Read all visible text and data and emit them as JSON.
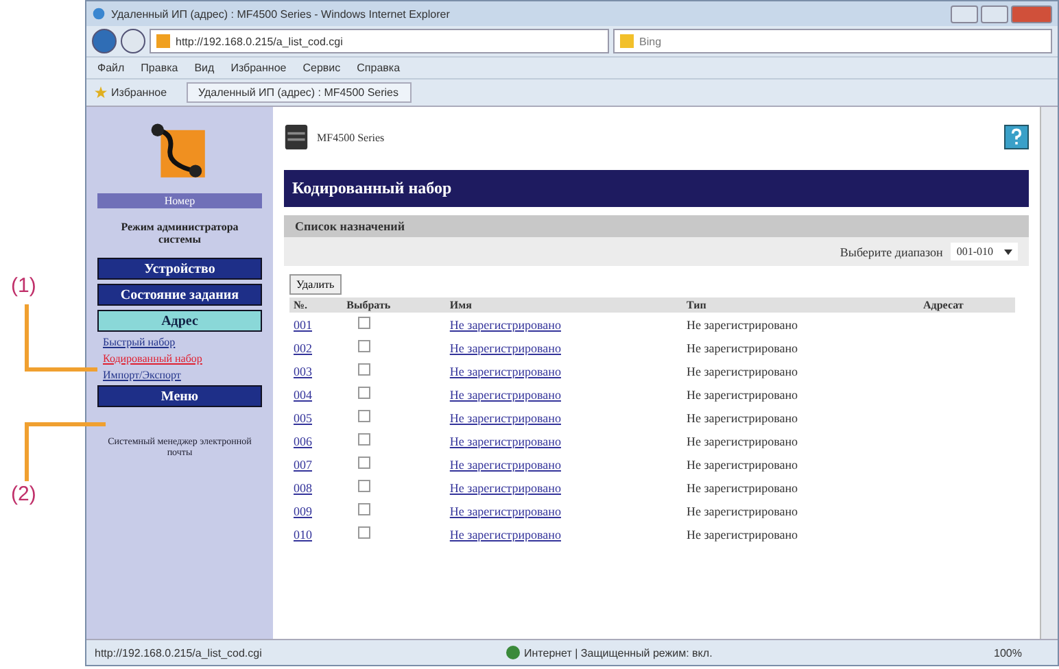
{
  "callouts": [
    {
      "label": "(1)"
    },
    {
      "label": "(2)"
    }
  ],
  "window": {
    "title": "Удаленный ИП (адрес) : MF4500 Series - Windows Internet Explorer"
  },
  "address_bar": {
    "url": "http://192.168.0.215/a_list_cod.cgi",
    "search_placeholder": "Bing"
  },
  "menu": [
    "Файл",
    "Правка",
    "Вид",
    "Избранное",
    "Сервис",
    "Справка"
  ],
  "favorites_bar": {
    "favorites": "Избранное",
    "tab": "Удаленный ИП (адрес) : MF4500 Series"
  },
  "sidebar": {
    "logo_caption": "Номер",
    "mode": "Режим администратора системы",
    "items": [
      {
        "kind": "button",
        "label": "Устройство",
        "selected": false
      },
      {
        "kind": "button",
        "label": "Состояние задания",
        "selected": false
      },
      {
        "kind": "button",
        "label": "Адрес",
        "selected": true
      },
      {
        "kind": "link",
        "label": "Быстрый набор",
        "selected": false
      },
      {
        "kind": "link",
        "label": "Кодированный набор",
        "selected": true
      },
      {
        "kind": "link",
        "label": "Импорт/Экспорт",
        "selected": false
      },
      {
        "kind": "button",
        "label": "Меню",
        "selected": false
      }
    ],
    "footer": "Системный менеджер электронной почты"
  },
  "content": {
    "device": "MF4500 Series",
    "title": "Кодированный набор",
    "section": "Список назначений",
    "range_label": "Выберите диапазон",
    "range_value": "001-010",
    "delete_button": "Удалить",
    "columns": [
      "№.",
      "Выбрать",
      "Имя",
      "Тип",
      "Адресат"
    ],
    "rows": [
      {
        "no": "001",
        "checked": false,
        "name": "Не зарегистрировано",
        "type": "Не зарегистрировано"
      },
      {
        "no": "002",
        "checked": false,
        "name": "Не зарегистрировано",
        "type": "Не зарегистрировано"
      },
      {
        "no": "003",
        "checked": false,
        "name": "Не зарегистрировано",
        "type": "Не зарегистрировано"
      },
      {
        "no": "004",
        "checked": false,
        "name": "Не зарегистрировано",
        "type": "Не зарегистрировано"
      },
      {
        "no": "005",
        "checked": false,
        "name": "Не зарегистрировано",
        "type": "Не зарегистрировано"
      },
      {
        "no": "006",
        "checked": false,
        "name": "Не зарегистрировано",
        "type": "Не зарегистрировано"
      },
      {
        "no": "007",
        "checked": false,
        "name": "Не зарегистрировано",
        "type": "Не зарегистрировано"
      },
      {
        "no": "008",
        "checked": false,
        "name": "Не зарегистрировано",
        "type": "Не зарегистрировано"
      },
      {
        "no": "009",
        "checked": false,
        "name": "Не зарегистрировано",
        "type": "Не зарегистрировано"
      },
      {
        "no": "010",
        "checked": false,
        "name": "Не зарегистрировано",
        "type": "Не зарегистрировано"
      }
    ]
  },
  "status_bar": {
    "url": "http://192.168.0.215/a_list_cod.cgi",
    "zone": "Интернет | Защищенный режим: вкл.",
    "zoom": "100%"
  }
}
